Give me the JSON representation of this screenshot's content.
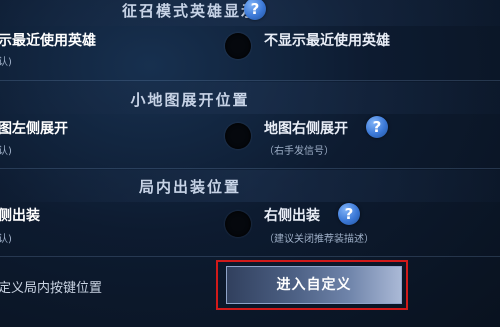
{
  "sections": [
    {
      "title": "征召模式英雄显示"
    },
    {
      "title": "小地图展开位置"
    },
    {
      "title": "局内出装位置"
    }
  ],
  "rows": [
    {
      "left_label": "示最近使用英雄",
      "left_sub": "认)",
      "right_label": "不显示最近使用英雄",
      "right_sub": ""
    },
    {
      "left_label": "图左侧展开",
      "left_sub": "认)",
      "right_label": "地图右侧展开",
      "right_sub": "（右手发信号）"
    },
    {
      "left_label": "侧出装",
      "left_sub": "认)",
      "right_label": "右侧出装",
      "right_sub": "（建议关闭推荐装描述）"
    }
  ],
  "help_glyph": "?",
  "custom_keys": {
    "label": "定义局内按键位置",
    "button_label": "进入自定义"
  },
  "colors": {
    "highlight": "#d11a1a",
    "help_icon": "#3b78d6"
  }
}
